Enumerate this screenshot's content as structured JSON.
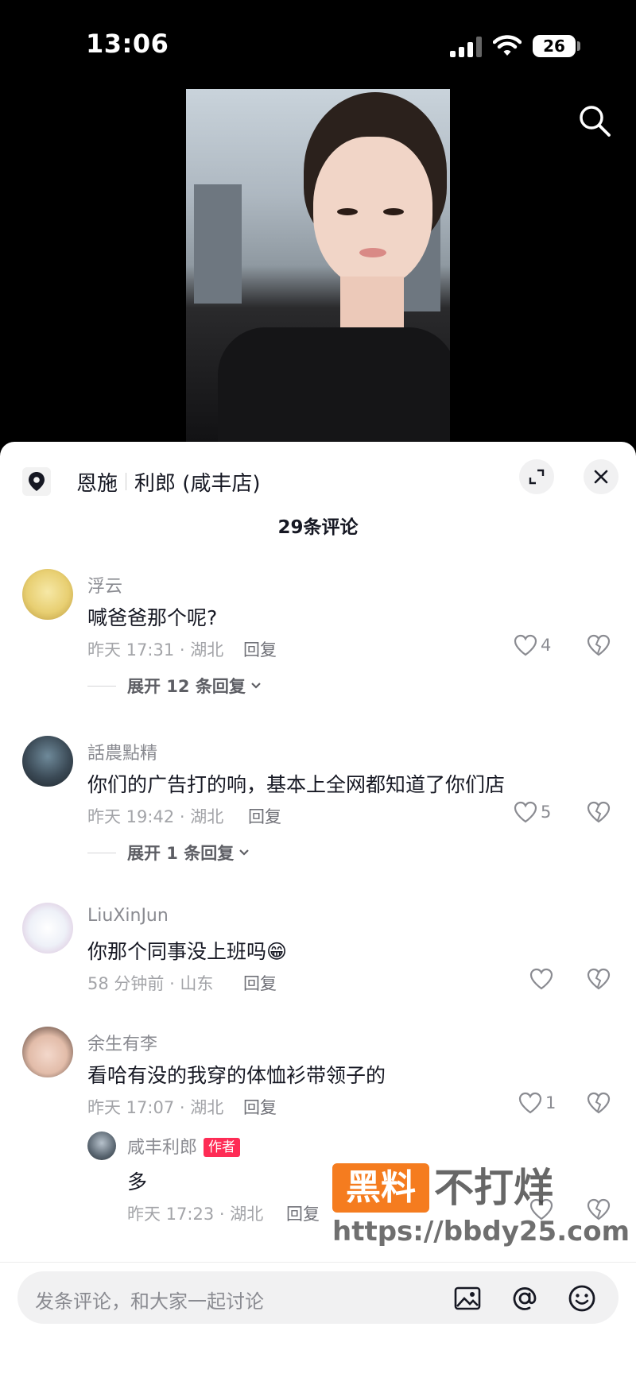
{
  "status_bar": {
    "time": "13:06",
    "battery": "26"
  },
  "location": {
    "city": "恩施",
    "store": "利郎 (咸丰店)"
  },
  "comments_header": {
    "count_label": "29条评论"
  },
  "comments": [
    {
      "user": "浮云",
      "text": "喊爸爸那个呢?",
      "meta": "昨天 17:31 · 湖北",
      "reply_label": "回复",
      "likes": "4",
      "expand_label": "展开 12 条回复"
    },
    {
      "user": "話農點精",
      "text": "你们的广告打的响，基本上全网都知道了你们店",
      "meta": "昨天 19:42 · 湖北",
      "reply_label": "回复",
      "likes": "5",
      "expand_label": "展开 1 条回复"
    },
    {
      "user": "LiuXinJun",
      "text": "你那个同事没上班吗😁",
      "meta": "58 分钟前 · 山东",
      "reply_label": "回复",
      "likes": ""
    },
    {
      "user": "余生有李",
      "text": "看哈有没的我穿的体恤衫带领子的",
      "meta": "昨天 17:07 · 湖北",
      "reply_label": "回复",
      "likes": "1"
    }
  ],
  "reply": {
    "user": "咸丰利郎",
    "tag": "作者",
    "text": "多",
    "meta": "昨天 17:23 · 湖北",
    "reply_label": "回复"
  },
  "watermark": {
    "box_text": "黑料",
    "right_text": "不打烊",
    "url": "https://bbdy25.com"
  },
  "input": {
    "placeholder": "发条评论，和大家一起讨论"
  },
  "icons": [
    "search-icon",
    "location-pin-icon",
    "expand-icon",
    "close-icon",
    "heart-icon",
    "dislike-heart-icon",
    "chevron-down-icon",
    "image-icon",
    "at-icon",
    "emoji-icon"
  ]
}
